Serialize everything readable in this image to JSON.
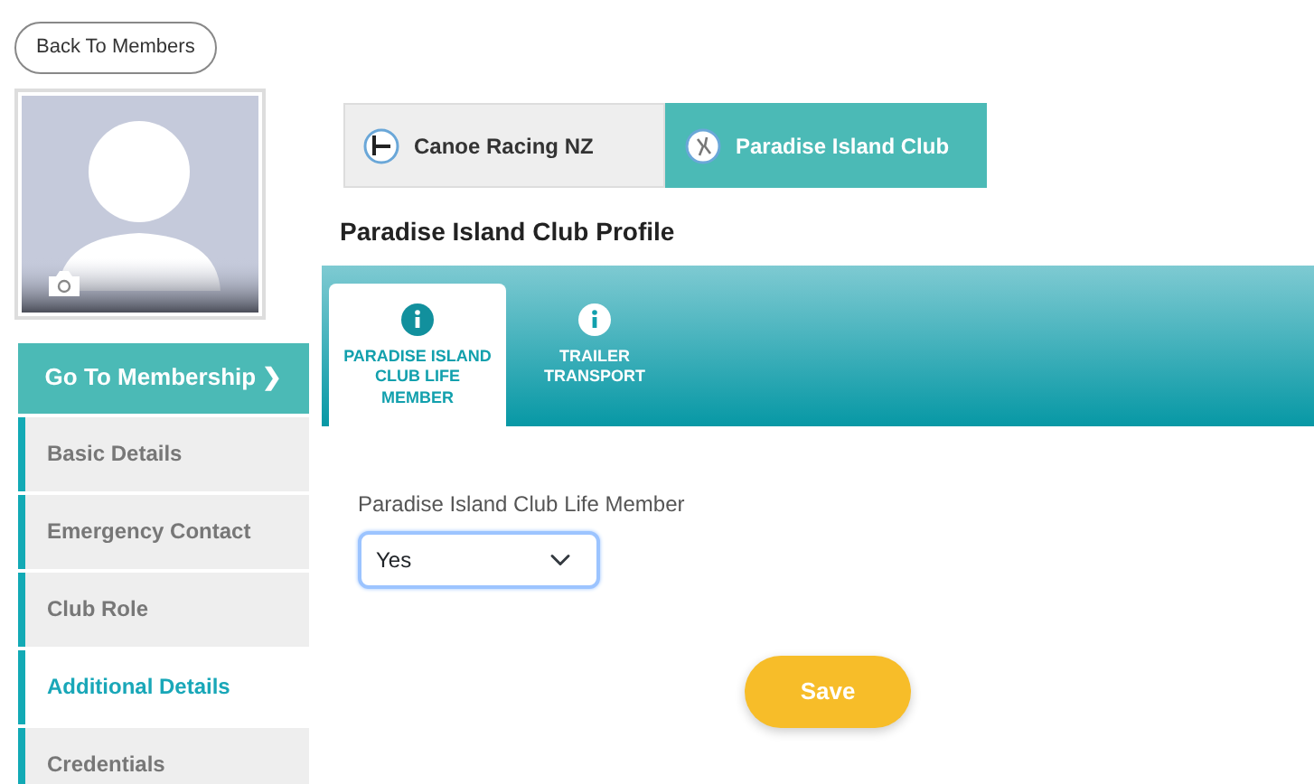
{
  "back_button": "Back To Members",
  "membership_button": "Go To Membership ❯",
  "sidebar": {
    "items": [
      {
        "label": "Basic Details",
        "selected": false
      },
      {
        "label": "Emergency Contact",
        "selected": false
      },
      {
        "label": "Club Role",
        "selected": false
      },
      {
        "label": "Additional Details",
        "selected": true
      },
      {
        "label": "Credentials",
        "selected": false
      }
    ]
  },
  "club_tabs": [
    {
      "label": "Canoe Racing NZ",
      "selected": false
    },
    {
      "label": "Paradise Island Club",
      "selected": true
    }
  ],
  "profile_title": "Paradise Island Club Profile",
  "section_tabs": [
    {
      "label": "PARADISE ISLAND CLUB LIFE MEMBER",
      "selected": true
    },
    {
      "label": "TRAILER TRANSPORT",
      "selected": false
    }
  ],
  "form": {
    "label": "Paradise Island Club Life Member",
    "value": "Yes"
  },
  "save_button": "Save"
}
